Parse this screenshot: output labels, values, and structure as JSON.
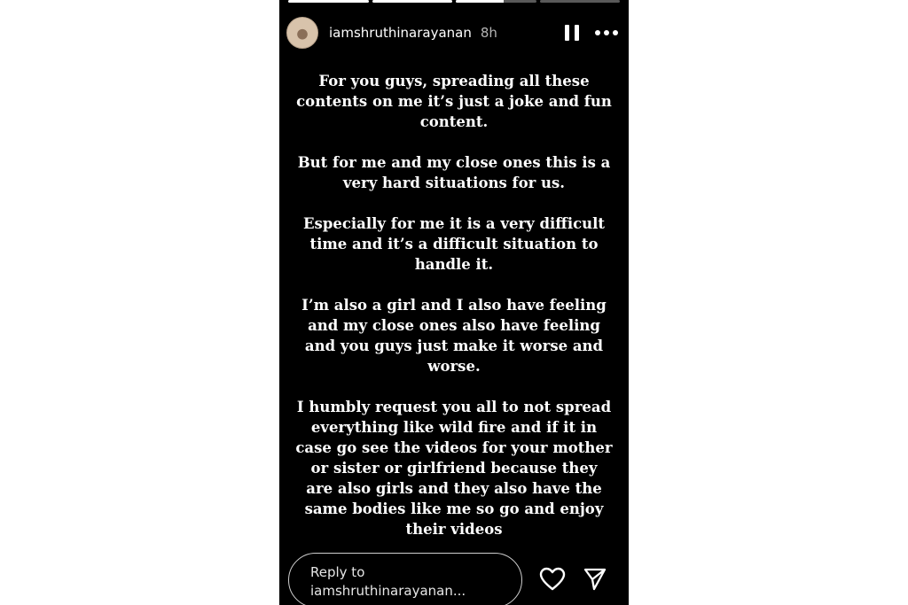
{
  "progress": {
    "segments": [
      1,
      1,
      0.6,
      0
    ]
  },
  "header": {
    "username": "iamshruthinarayanan",
    "time": "8h",
    "icons": [
      "avatar",
      "pause-icon",
      "more-icon"
    ]
  },
  "story": {
    "paragraphs": [
      [
        "For you guys, spreading all these",
        "contents on me it’s just a joke and fun",
        "content."
      ],
      [
        "But for me and my close ones this is a",
        "very hard situations for us."
      ],
      [
        "Especially for me it is a very difficult",
        "time and it’s a difficult situation to",
        "handle it."
      ],
      [
        "I’m also a girl and I also have feeling",
        "and my close ones also have feeling",
        "and you guys just make it worse and",
        "worse."
      ],
      [
        "I humbly request you all to not spread",
        "everything like wild fire and if it in",
        "case go see the videos for your mother",
        "or sister or girlfriend because they",
        "are also girls and they also have the",
        "same bodies like me so go and enjoy",
        "their videos"
      ]
    ]
  },
  "footer": {
    "reply_line1": "Reply to",
    "reply_line2": "iamshruthinarayanan...",
    "icons": [
      "heart-icon",
      "send-icon"
    ]
  },
  "colors": {
    "story_bg": "#000000",
    "page_bg": "#ffffff",
    "text": "#ffffff",
    "muted": "#b5b5b5"
  }
}
